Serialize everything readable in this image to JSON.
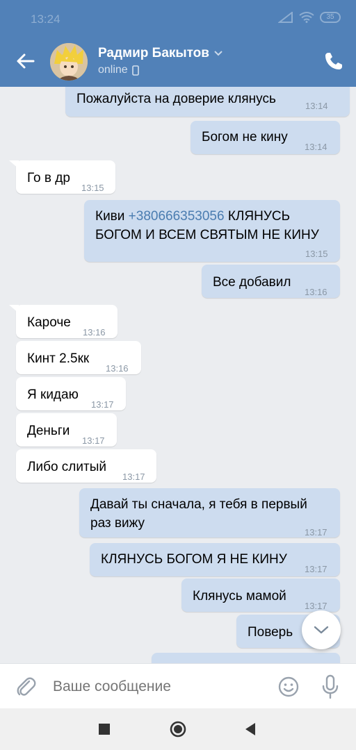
{
  "status_bar": {
    "time": "13:24",
    "battery": "35"
  },
  "header": {
    "contact_name": "Радмир Бакытов",
    "contact_status": "online"
  },
  "messages": [
    {
      "text": "Пожалуйста на доверие клянусь",
      "time": "13:14",
      "direction": "out"
    },
    {
      "text": "Богом не кину",
      "time": "13:14",
      "direction": "out"
    },
    {
      "text": "Го в др",
      "time": "13:15",
      "direction": "in"
    },
    {
      "text_prefix": "Киви ",
      "phone": "+380666353056",
      "text_suffix": " КЛЯНУСЬ",
      "text_line2": "БОГОМ И ВСЕМ СВЯТЫМ НЕ КИНУ",
      "time": "13:15",
      "direction": "out"
    },
    {
      "text": "Все добавил",
      "time": "13:16",
      "direction": "out"
    },
    {
      "text": "Кароче",
      "time": "13:16",
      "direction": "in"
    },
    {
      "text": "Кинт 2.5кк",
      "time": "13:16",
      "direction": "in"
    },
    {
      "text": "Я кидаю",
      "time": "13:17",
      "direction": "in"
    },
    {
      "text": "Деньги",
      "time": "13:17",
      "direction": "in"
    },
    {
      "text": "Либо слитый",
      "time": "13:17",
      "direction": "in"
    },
    {
      "text_line1": "Давай ты сначала, я тебя в первый",
      "text_line2": "раз вижу",
      "time": "13:17",
      "direction": "out"
    },
    {
      "text": "КЛЯНУСЬ БОГОМ Я НЕ КИНУ",
      "time": "13:17",
      "direction": "out"
    },
    {
      "text": "Клянусь мамой",
      "time": "13:17",
      "direction": "out"
    },
    {
      "text": "Поверь",
      "direction": "out"
    }
  ],
  "composer": {
    "placeholder": "Ваше сообщение"
  },
  "icons": {
    "back": "arrow-left-icon",
    "call": "phone-icon",
    "attach": "paperclip-icon",
    "emoji": "smile-icon",
    "mic": "microphone-icon",
    "scroll_down": "chevron-down-icon"
  },
  "colors": {
    "header": "#5181b8",
    "outgoing_bubble": "#cddcef",
    "incoming_bubble": "#ffffff",
    "background": "#ebedf0",
    "link": "#4a7cb0"
  }
}
